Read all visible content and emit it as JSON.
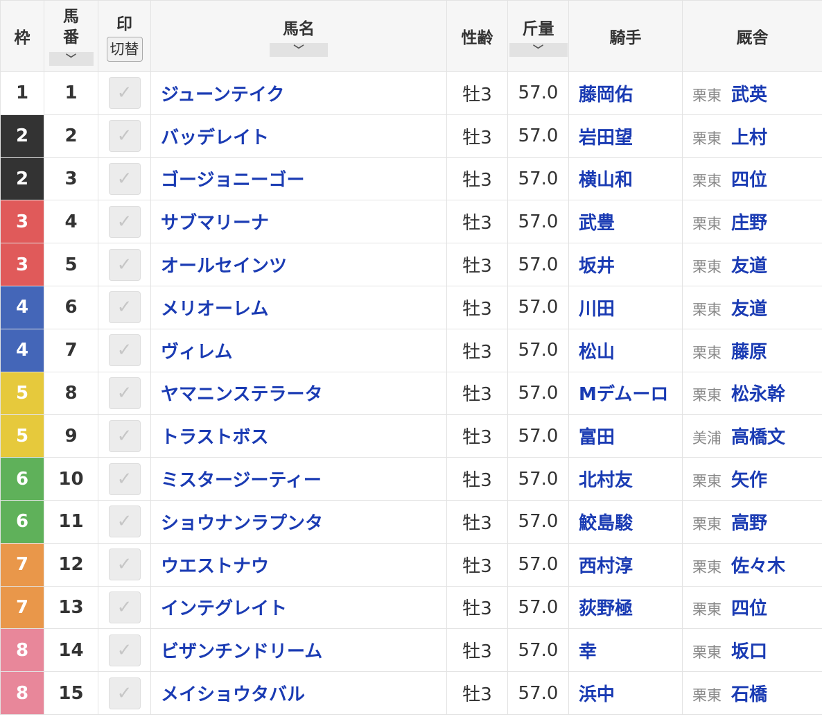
{
  "headers": {
    "frame": "枠",
    "number": [
      "馬",
      "番"
    ],
    "mark": "印",
    "mark_switch": "切替",
    "horse": "馬名",
    "sex_age": "性齢",
    "weight": "斤量",
    "jockey": "騎手",
    "stable": "厩舎",
    "sort_icon": "﹀"
  },
  "frame_colors": {
    "1": "#ffffff",
    "2": "#333333",
    "3": "#e05a5a",
    "4": "#4466b8",
    "5": "#e6c93c",
    "6": "#5fb15a",
    "7": "#e9974a",
    "8": "#e8879a"
  },
  "rows": [
    {
      "frame": "1",
      "number": "1",
      "mark": "✓",
      "horse": "ジューンテイク",
      "sex_age": "牡3",
      "weight": "57.0",
      "jockey": "藤岡佑",
      "stable_region": "栗東",
      "trainer": "武英"
    },
    {
      "frame": "2",
      "number": "2",
      "mark": "✓",
      "horse": "バッデレイト",
      "sex_age": "牡3",
      "weight": "57.0",
      "jockey": "岩田望",
      "stable_region": "栗東",
      "trainer": "上村"
    },
    {
      "frame": "2",
      "number": "3",
      "mark": "✓",
      "horse": "ゴージョニーゴー",
      "sex_age": "牡3",
      "weight": "57.0",
      "jockey": "横山和",
      "stable_region": "栗東",
      "trainer": "四位"
    },
    {
      "frame": "3",
      "number": "4",
      "mark": "✓",
      "horse": "サブマリーナ",
      "sex_age": "牡3",
      "weight": "57.0",
      "jockey": "武豊",
      "stable_region": "栗東",
      "trainer": "庄野"
    },
    {
      "frame": "3",
      "number": "5",
      "mark": "✓",
      "horse": "オールセインツ",
      "sex_age": "牡3",
      "weight": "57.0",
      "jockey": "坂井",
      "stable_region": "栗東",
      "trainer": "友道"
    },
    {
      "frame": "4",
      "number": "6",
      "mark": "✓",
      "horse": "メリオーレム",
      "sex_age": "牡3",
      "weight": "57.0",
      "jockey": "川田",
      "stable_region": "栗東",
      "trainer": "友道"
    },
    {
      "frame": "4",
      "number": "7",
      "mark": "✓",
      "horse": "ヴィレム",
      "sex_age": "牡3",
      "weight": "57.0",
      "jockey": "松山",
      "stable_region": "栗東",
      "trainer": "藤原"
    },
    {
      "frame": "5",
      "number": "8",
      "mark": "✓",
      "horse": "ヤマニンステラータ",
      "sex_age": "牡3",
      "weight": "57.0",
      "jockey": "Mデムーロ",
      "stable_region": "栗東",
      "trainer": "松永幹"
    },
    {
      "frame": "5",
      "number": "9",
      "mark": "✓",
      "horse": "トラストボス",
      "sex_age": "牡3",
      "weight": "57.0",
      "jockey": "富田",
      "stable_region": "美浦",
      "trainer": "高橋文"
    },
    {
      "frame": "6",
      "number": "10",
      "mark": "✓",
      "horse": "ミスタージーティー",
      "sex_age": "牡3",
      "weight": "57.0",
      "jockey": "北村友",
      "stable_region": "栗東",
      "trainer": "矢作"
    },
    {
      "frame": "6",
      "number": "11",
      "mark": "✓",
      "horse": "ショウナンラプンタ",
      "sex_age": "牡3",
      "weight": "57.0",
      "jockey": "鮫島駿",
      "stable_region": "栗東",
      "trainer": "高野"
    },
    {
      "frame": "7",
      "number": "12",
      "mark": "✓",
      "horse": "ウエストナウ",
      "sex_age": "牡3",
      "weight": "57.0",
      "jockey": "西村淳",
      "stable_region": "栗東",
      "trainer": "佐々木"
    },
    {
      "frame": "7",
      "number": "13",
      "mark": "✓",
      "horse": "インテグレイト",
      "sex_age": "牡3",
      "weight": "57.0",
      "jockey": "荻野極",
      "stable_region": "栗東",
      "trainer": "四位"
    },
    {
      "frame": "8",
      "number": "14",
      "mark": "✓",
      "horse": "ビザンチンドリーム",
      "sex_age": "牡3",
      "weight": "57.0",
      "jockey": "幸",
      "stable_region": "栗東",
      "trainer": "坂口"
    },
    {
      "frame": "8",
      "number": "15",
      "mark": "✓",
      "horse": "メイショウタバル",
      "sex_age": "牡3",
      "weight": "57.0",
      "jockey": "浜中",
      "stable_region": "栗東",
      "trainer": "石橋"
    }
  ]
}
